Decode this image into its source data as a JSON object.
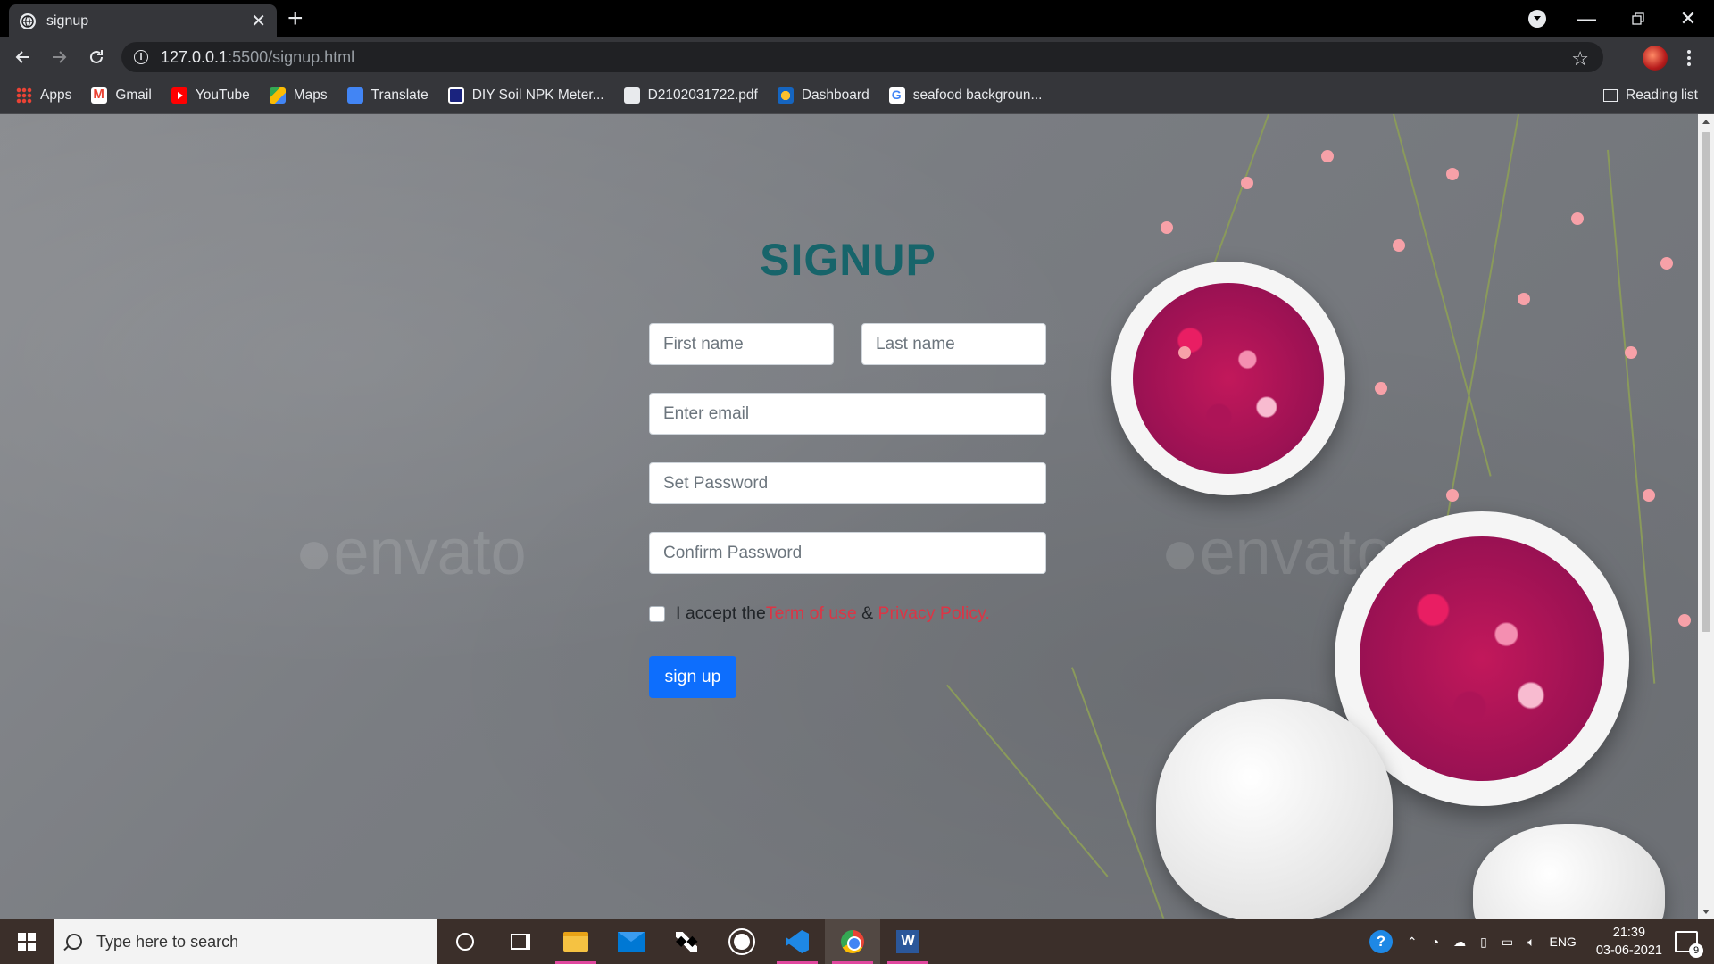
{
  "browser": {
    "tab_title": "signup",
    "url_host": "127.0.0.1",
    "url_path": ":5500/signup.html",
    "bookmarks": [
      {
        "label": "Apps",
        "icon": "apps-grid-icon"
      },
      {
        "label": "Gmail",
        "icon": "gmail-icon"
      },
      {
        "label": "YouTube",
        "icon": "youtube-icon"
      },
      {
        "label": "Maps",
        "icon": "maps-icon"
      },
      {
        "label": "Translate",
        "icon": "translate-icon"
      },
      {
        "label": "DIY Soil NPK Meter...",
        "icon": "document-icon"
      },
      {
        "label": "D2102031722.pdf",
        "icon": "globe-icon"
      },
      {
        "label": "Dashboard",
        "icon": "dashboard-icon"
      },
      {
        "label": "seafood backgroun...",
        "icon": "google-icon"
      }
    ],
    "reading_list": "Reading list"
  },
  "page": {
    "title": "SIGNUP",
    "first_name_placeholder": "First name",
    "last_name_placeholder": "Last name",
    "email_placeholder": "Enter email",
    "password_placeholder": "Set Password",
    "confirm_placeholder": "Confirm Password",
    "terms_prefix": "I accept the",
    "terms_link": "Term of use",
    "terms_and": " & ",
    "privacy_link": "Privacy Policy.",
    "signup_button": "sign up",
    "accent_color": "#17646a",
    "button_color": "#0d6efd",
    "link_color": "#dc3545"
  },
  "taskbar": {
    "search_placeholder": "Type here to search",
    "language": "ENG",
    "time": "21:39",
    "date": "03-06-2021",
    "notification_count": "9"
  }
}
